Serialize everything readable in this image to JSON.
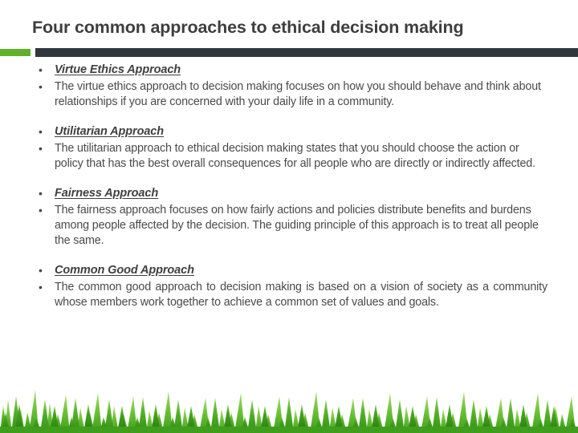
{
  "slide": {
    "title": "Four common approaches to ethical decision making",
    "accent_color": "#61b12b",
    "rule_color": "#30373f",
    "title_color": "#3e3e3e",
    "body_color": "#4a4a4a",
    "background_color": "#ffffff",
    "bullet_glyph": "•"
  },
  "blocks": [
    {
      "heading": "Virtue Ethics Approach",
      "body": "The virtue ethics approach to decision making focuses on how you should behave and think about relationships if you are concerned with your daily life in a community."
    },
    {
      "heading": "Utilitarian Approach",
      "body": "The utilitarian approach to ethical decision making states that you should choose the action or policy that has the best overall consequences for all people who are directly or indirectly affected."
    },
    {
      "heading": "Fairness Approach",
      "body": "The fairness approach focuses on how fairly actions and policies distribute benefits and burdens among people affected by the decision. The guiding principle of this approach is to treat all people the same."
    },
    {
      "heading": "Common Good Approach",
      "body": "The common good approach to decision making is based on a vision of society as a community whose members work together to achieve a common set of values and goals."
    }
  ],
  "footer": {
    "decoration": "grass-border",
    "grass_color_light": "#7ac943",
    "grass_color_mid": "#4caf26",
    "grass_color_dark": "#2f8f12"
  }
}
